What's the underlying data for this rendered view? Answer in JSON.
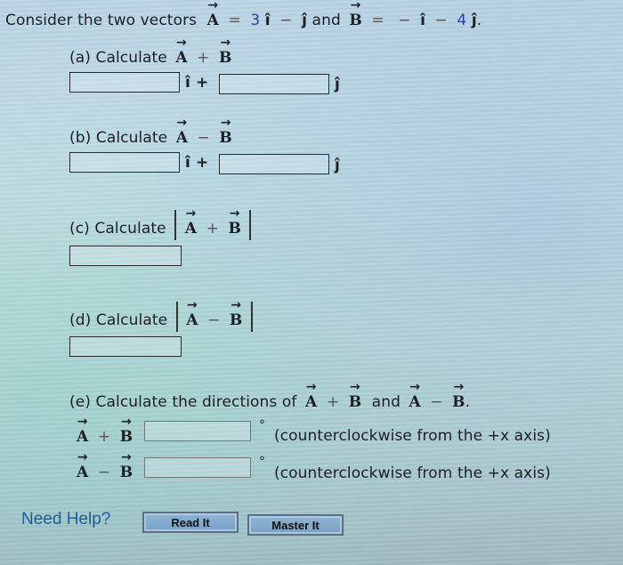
{
  "intro": {
    "lead": "Consider the two vectors",
    "vecA": "A",
    "eq1": "=",
    "a_coef_i": "3",
    "i_hat": "î",
    "minus1": "−",
    "j_hat": "ĵ",
    "and": "and",
    "vecB": "B",
    "eq2": "=",
    "minus2": "−",
    "minus3": "−",
    "b_coef_j": "4",
    "period": "."
  },
  "parts": {
    "a": {
      "label": "(a) Calculate",
      "vec1": "A",
      "op": "+",
      "vec2": "B",
      "i_suffix": "î +",
      "j_suffix": "ĵ",
      "input_i": "",
      "input_j": ""
    },
    "b": {
      "label": "(b) Calculate",
      "vec1": "A",
      "op": "−",
      "vec2": "B",
      "i_suffix": "î +",
      "j_suffix": "ĵ",
      "input_i": "",
      "input_j": ""
    },
    "c": {
      "label": "(c) Calculate",
      "vec1": "A",
      "op": "+",
      "vec2": "B",
      "input": ""
    },
    "d": {
      "label": "(d) Calculate",
      "vec1": "A",
      "op": "−",
      "vec2": "B",
      "input": ""
    },
    "e": {
      "label": "(e) Calculate the directions of",
      "and": "and",
      "period": ".",
      "rows": [
        {
          "vec1": "A",
          "op": "+",
          "vec2": "B",
          "unit": "°",
          "note": "(counterclockwise from the +x axis)",
          "input": ""
        },
        {
          "vec1": "A",
          "op": "−",
          "vec2": "B",
          "unit": "°",
          "note": "(counterclockwise from the +x axis)",
          "input": ""
        }
      ]
    }
  },
  "help": {
    "label": "Need Help?",
    "read_it": "Read It",
    "master_it": "Master It"
  },
  "colors": {
    "help_text": "#1f5e9a",
    "coef_blue": "#2d3fa0",
    "button_fill": "#7aa2c7"
  }
}
